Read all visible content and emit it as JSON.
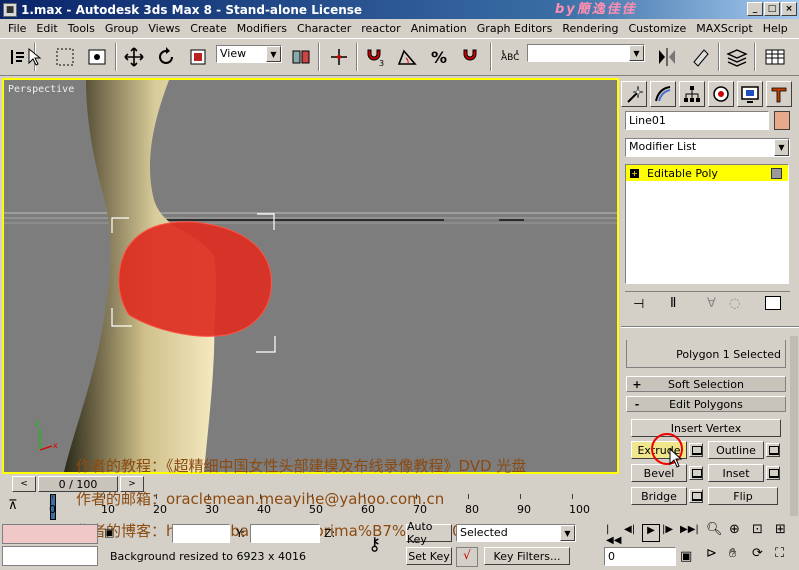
{
  "window": {
    "title": "1.max - Autodesk 3ds Max 8 - Stand-alone License",
    "watermark": "by簡逸佳佳"
  },
  "menu": [
    "File",
    "Edit",
    "Tools",
    "Group",
    "Views",
    "Create",
    "Modifiers",
    "Character",
    "reactor",
    "Animation",
    "Graph Editors",
    "Rendering",
    "Customize",
    "MAXScript",
    "Help"
  ],
  "toolbar": {
    "view_combo": "View",
    "selection_set_combo": ""
  },
  "viewport": {
    "label": "Perspective",
    "border_color": "#ffff00",
    "background": "#7d7d7d"
  },
  "command_panel": {
    "object_name": "Line01",
    "object_color": "#e8a88a",
    "modifier_list": "Modifier List",
    "stack_item": "Editable Poly",
    "selection_info": "Polygon 1 Selected",
    "rollouts": {
      "soft_selection": "Soft Selection",
      "edit_polygons": "Edit Polygons"
    },
    "buttons": {
      "insert_vertex": "Insert Vertex",
      "extrude": "Extrude",
      "outline": "Outline",
      "bevel": "Bevel",
      "inset": "Inset",
      "bridge": "Bridge",
      "flip": "Flip"
    }
  },
  "timeline": {
    "frame": "0 / 100",
    "ticks": [
      "0",
      "10",
      "20",
      "30",
      "40",
      "50",
      "60",
      "70",
      "80",
      "90",
      "100"
    ]
  },
  "status": {
    "prompt": "Background resized to 6923 x 4016",
    "y_label": "Y:",
    "z_label": "Z:",
    "auto_key": "Auto Key",
    "selected_combo": "Selected",
    "set_key": "Set Key",
    "key_filters": "Key Filters...",
    "frame_field": "0"
  },
  "overlay": {
    "line1": "作者的教程：《超精细中国女性头部建模及布线录像教程》DVD 光盘",
    "line2_label": "作者的邮箱：",
    "line2_value": "oraclemean.meayihe@yahoo.com.cn",
    "line3_label": "作者的博客：",
    "line3_value": "http://hi.baidu.com/prima%B7%C9%D0%D0%D5%DF"
  }
}
